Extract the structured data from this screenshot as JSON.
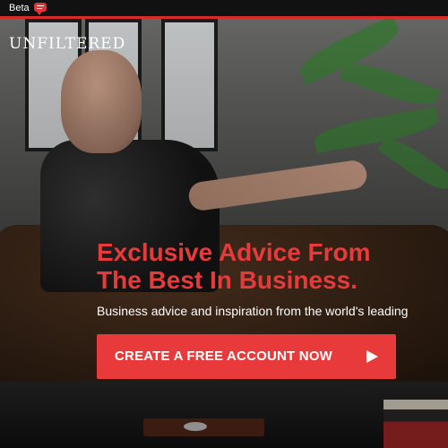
{
  "topbar": {
    "beta_label": "Beta",
    "icons": {
      "beta_badge": "chat-bubble-icon"
    },
    "accent_color": "#d62b2b"
  },
  "brand": {
    "logo_text": "UNFILTERED"
  },
  "hero": {
    "headline_line1": "Exclusive Advice From",
    "headline_line2": "The Best In Business.",
    "subheadline": "Business advice and inspiration from the world's leading",
    "cta": {
      "label": "CREATE A FREE ACCOUNT NOW",
      "icon": "play-icon",
      "color": "#e83a3a"
    }
  }
}
